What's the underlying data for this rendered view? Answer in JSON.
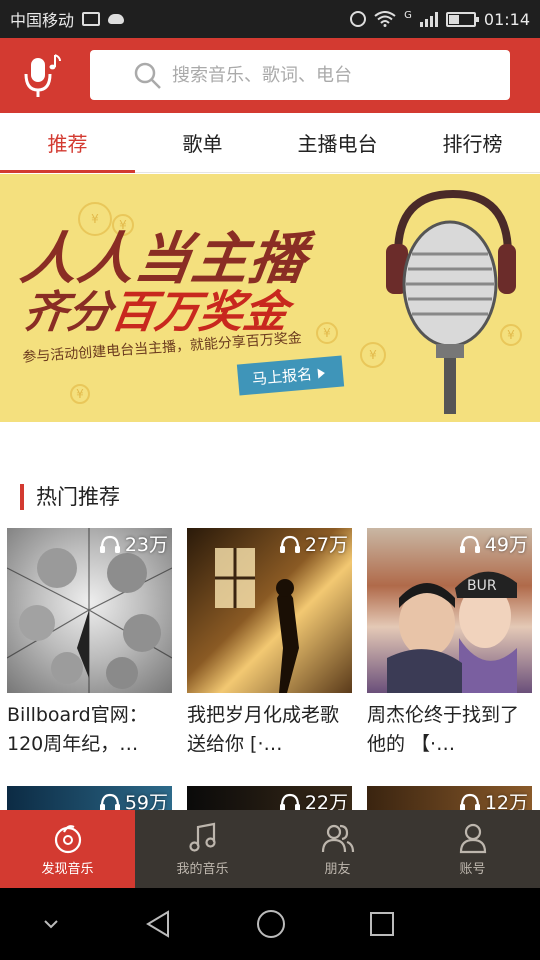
{
  "status_bar": {
    "carrier": "中国移动",
    "network": "G",
    "time": "01:14"
  },
  "search": {
    "placeholder": "搜索音乐、歌词、电台"
  },
  "tabs": [
    {
      "label": "推荐",
      "active": true
    },
    {
      "label": "歌单",
      "active": false
    },
    {
      "label": "主播电台",
      "active": false
    },
    {
      "label": "排行榜",
      "active": false
    }
  ],
  "banner": {
    "title": "人人当主播",
    "subtitle_pre": "齐分",
    "subtitle_highlight": "百万奖金",
    "description": "参与活动创建电台当主播，就能分享百万奖金",
    "button": "马上报名"
  },
  "hot": {
    "title": "热门推荐",
    "items": [
      {
        "count": "23万",
        "caption": "Billboard官网：120周年纪，…"
      },
      {
        "count": "27万",
        "caption": "我把岁月化成老歌送给你 [·…"
      },
      {
        "count": "49万",
        "caption": "周杰伦终于找到了他的 【·…"
      },
      {
        "count": "59万",
        "caption": ""
      },
      {
        "count": "22万",
        "caption": ""
      },
      {
        "count": "12万",
        "caption": ""
      }
    ]
  },
  "bottom_nav": [
    {
      "label": "发现音乐",
      "icon": "discover-icon",
      "active": true
    },
    {
      "label": "我的音乐",
      "icon": "music-note-icon",
      "active": false
    },
    {
      "label": "朋友",
      "icon": "friends-icon",
      "active": false
    },
    {
      "label": "账号",
      "icon": "account-icon",
      "active": false
    }
  ],
  "colors": {
    "accent": "#d33a31",
    "nav_bg": "#3a3631",
    "banner_bg": "#f4e07e"
  }
}
